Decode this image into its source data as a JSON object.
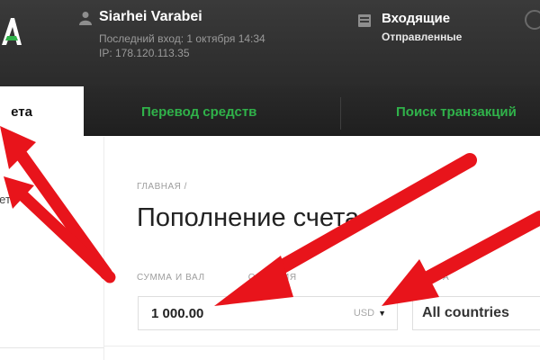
{
  "header": {
    "user_name": "Siarhei Varabei",
    "last_login": "Последний вход: 1 октября 14:34",
    "ip": "IP: 178.120.113.35",
    "mail_inbox": "Входящие",
    "mail_sent": "Отправленные"
  },
  "tabs": {
    "active": "ета",
    "transfer": "Перевод средств",
    "search": "Поиск транзакций"
  },
  "sidebar": {
    "item": "нет"
  },
  "main": {
    "breadcrumb": "ГЛАВНАЯ /",
    "title": "Пополнение счета",
    "amount_label": "СУММА И ВАЛ",
    "amount_label_tail": "ОЛНЕНИЯ",
    "country_label": "А",
    "amount_value": "1 000.00",
    "currency": "USD",
    "country_value": "All countries"
  },
  "colors": {
    "header_bg": "#2b2b2b",
    "tab_green": "#30b24a",
    "arrow_red": "#e8141b"
  },
  "icons": {
    "logo": "brand-logo-icon",
    "user": "user-icon",
    "mail": "mail-icon",
    "currency_caret": "caret-down-icon"
  }
}
